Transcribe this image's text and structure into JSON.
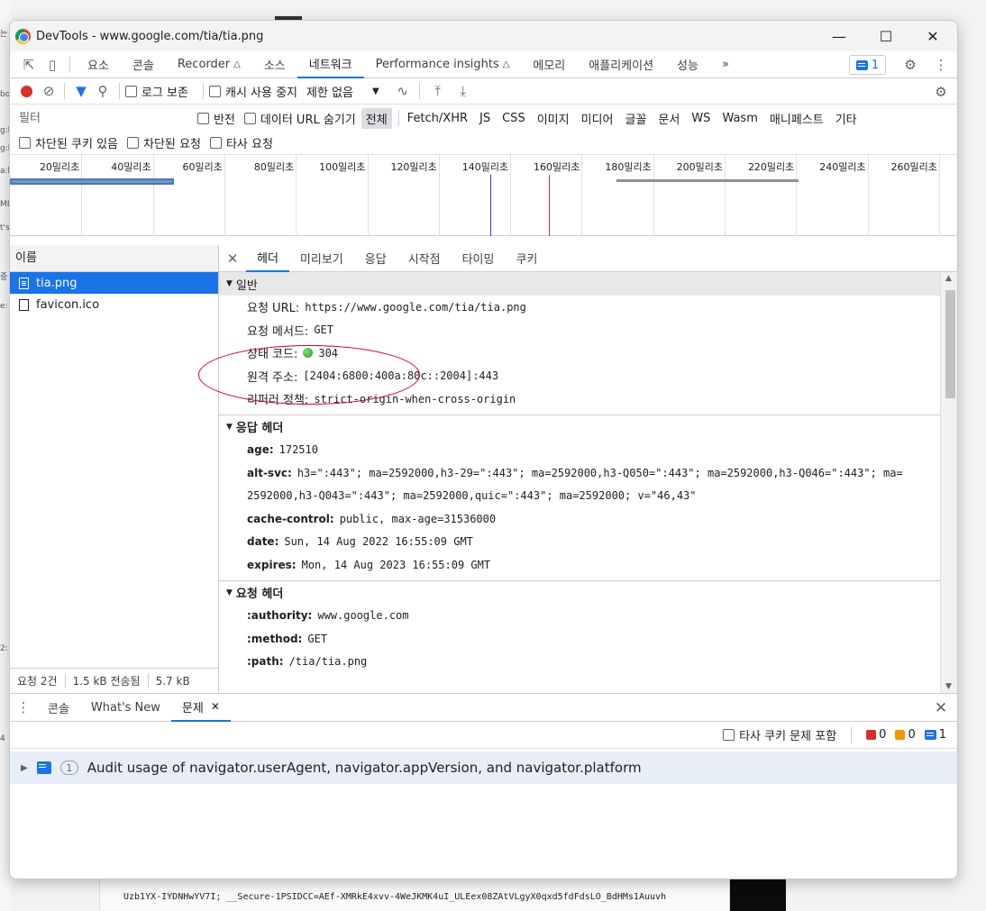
{
  "window": {
    "title": "DevTools - www.google.com/tia/tia.png"
  },
  "main_tabs": [
    "요소",
    "콘솔",
    "Recorder",
    "소스",
    "네트워크",
    "Performance insights",
    "메모리",
    "애플리케이션",
    "성능"
  ],
  "more_tabs": "»",
  "issues_count": "1",
  "net_toolbar": {
    "preserve_log": "로그 보존",
    "disable_cache": "캐시 사용 중지",
    "throttling": "제한 없음"
  },
  "filter": {
    "placeholder": "필터",
    "invert": "반전",
    "hide_data_urls": "데이터 URL 숨기기",
    "types": [
      "전체",
      "Fetch/XHR",
      "JS",
      "CSS",
      "이미지",
      "미디어",
      "글꼴",
      "문서",
      "WS",
      "Wasm",
      "매니페스트",
      "기타"
    ],
    "blocked_cookies": "차단된 쿠키 있음",
    "blocked_requests": "차단된 요청",
    "third_party": "타사 요청"
  },
  "overview_ticks": [
    "20밀리초",
    "40밀리초",
    "60밀리초",
    "80밀리초",
    "100밀리초",
    "120밀리초",
    "140밀리초",
    "160밀리초",
    "180밀리초",
    "200밀리초",
    "220밀리초",
    "240밀리초",
    "260밀리초"
  ],
  "request_list": {
    "header": "이름",
    "rows": [
      "tia.png",
      "favicon.ico"
    ],
    "status": [
      "요청 2건",
      "1.5 kB 전송됨",
      "5.7 kB"
    ]
  },
  "detail_tabs": [
    "헤더",
    "미리보기",
    "응답",
    "시작점",
    "타이밍",
    "쿠키"
  ],
  "general": {
    "title": "일반",
    "request_url_k": "요청 URL:",
    "request_url_v": "https://www.google.com/tia/tia.png",
    "method_k": "요청 메서드:",
    "method_v": "GET",
    "status_k": "상태 코드:",
    "status_v": "304",
    "remote_k": "원격 주소:",
    "remote_v": "[2404:6800:400a:80c::2004]:443",
    "referrer_k": "리퍼러 정책:",
    "referrer_v": "strict-origin-when-cross-origin"
  },
  "response_headers": {
    "title": "응답 헤더",
    "age_k": "age:",
    "age_v": "172510",
    "altsvc_k": "alt-svc:",
    "altsvc_v1": "h3=\":443\"; ma=2592000,h3-29=\":443\"; ma=2592000,h3-Q050=\":443\"; ma=2592000,h3-Q046=\":443\"; ma=",
    "altsvc_v2": "2592000,h3-Q043=\":443\"; ma=2592000,quic=\":443\"; ma=2592000; v=\"46,43\"",
    "cache_k": "cache-control:",
    "cache_v": "public, max-age=31536000",
    "date_k": "date:",
    "date_v": "Sun, 14 Aug 2022 16:55:09 GMT",
    "expires_k": "expires:",
    "expires_v": "Mon, 14 Aug 2023 16:55:09 GMT"
  },
  "request_headers": {
    "title": "요청 헤더",
    "authority_k": ":authority:",
    "authority_v": "www.google.com",
    "method_k": ":method:",
    "method_v": "GET",
    "path_k": ":path:",
    "path_v": "/tia/tia.png"
  },
  "drawer": {
    "tabs": [
      "콘솔",
      "What's New",
      "문제"
    ],
    "third_party_issues": "타사 쿠키 문제 포함",
    "error_count": "0",
    "warning_count": "0",
    "info_count": "1",
    "issue_count": "1",
    "issue_text": "Audit usage of navigator.userAgent, navigator.appVersion, and navigator.platform"
  },
  "background": {
    "line1": "Uzb1YX-IYDNHwYV7I; __Secure-1PSIDCC=AEf-XMRkE4xvv-4WeJKMK4uI_ULEex08ZAtVLgyX0qxd5fdFdsLO_BdHMs1Auuvh",
    "left_fragments": [
      "는",
      "bo",
      "g:b",
      "g:b",
      "a:b",
      "MB",
      "t's",
      "중",
      "e:",
      "2:",
      "4"
    ]
  },
  "colors": {
    "accent": "#1a73e8",
    "record": "#d93025",
    "annotation": "#d0021b"
  }
}
